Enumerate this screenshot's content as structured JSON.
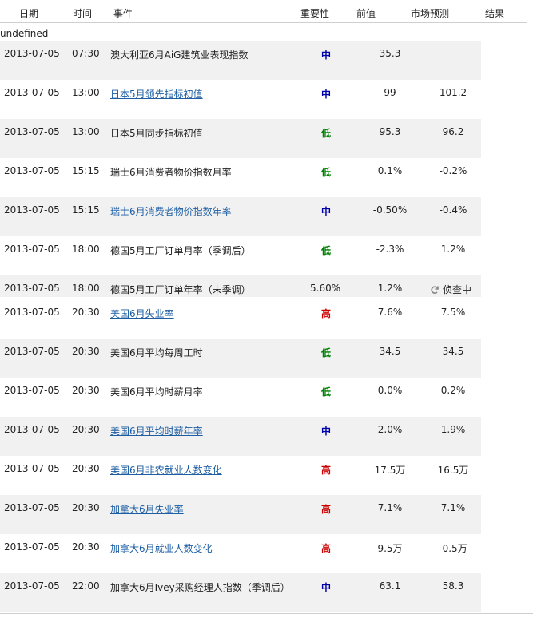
{
  "header": {
    "date": "日期",
    "time": "时间",
    "event": "事件",
    "importance": "重要性",
    "previous": "前值",
    "forecast": "市场预测",
    "result": "结果"
  },
  "undefined_text": "undefined",
  "importance_colors": {
    "低": "#008000",
    "中": "#0000aa",
    "高": "#cc0000"
  },
  "rows": [
    {
      "date": "2013-07-05",
      "time": "07:30",
      "event": "澳大利亚6月AiG建筑业表现指数",
      "link": false,
      "importance": "中",
      "previous": "35.3",
      "forecast": ""
    },
    {
      "date": "2013-07-05",
      "time": "13:00",
      "event": "日本5月领先指标初值",
      "link": true,
      "importance": "中",
      "previous": "99",
      "forecast": "101.2"
    },
    {
      "date": "2013-07-05",
      "time": "13:00",
      "event": "日本5月同步指标初值",
      "link": false,
      "importance": "低",
      "previous": "95.3",
      "forecast": "96.2"
    },
    {
      "date": "2013-07-05",
      "time": "15:15",
      "event": "瑞士6月消费者物价指数月率",
      "link": false,
      "importance": "低",
      "previous": "0.1%",
      "forecast": "-0.2%"
    },
    {
      "date": "2013-07-05",
      "time": "15:15",
      "event": "瑞士6月消费者物价指数年率",
      "link": true,
      "importance": "中",
      "previous": "-0.50%",
      "forecast": "-0.4%"
    },
    {
      "date": "2013-07-05",
      "time": "18:00",
      "event": "德国5月工厂订单月率（季调后）",
      "link": false,
      "importance": "低",
      "previous": "-2.3%",
      "forecast": "1.2%"
    },
    {
      "date": "2013-07-05",
      "time": "18:00",
      "event": "德国5月工厂订单年率（未季调）",
      "link": false,
      "importance": "",
      "actual": "5.60%",
      "previous": "1.2%",
      "forecast": "",
      "status": "侦查中"
    },
    {
      "date": "2013-07-05",
      "time": "20:30",
      "event": "美国6月失业率",
      "link": true,
      "importance": "高",
      "previous": "7.6%",
      "forecast": "7.5%"
    },
    {
      "date": "2013-07-05",
      "time": "20:30",
      "event": "美国6月平均每周工时",
      "link": false,
      "importance": "低",
      "previous": "34.5",
      "forecast": "34.5"
    },
    {
      "date": "2013-07-05",
      "time": "20:30",
      "event": "美国6月平均时薪月率",
      "link": false,
      "importance": "低",
      "previous": "0.0%",
      "forecast": "0.2%"
    },
    {
      "date": "2013-07-05",
      "time": "20:30",
      "event": "美国6月平均时薪年率",
      "link": true,
      "importance": "中",
      "previous": "2.0%",
      "forecast": "1.9%"
    },
    {
      "date": "2013-07-05",
      "time": "20:30",
      "event": "美国6月非农就业人数变化",
      "link": true,
      "importance": "高",
      "previous": "17.5万",
      "forecast": "16.5万"
    },
    {
      "date": "2013-07-05",
      "time": "20:30",
      "event": "加拿大6月失业率",
      "link": true,
      "importance": "高",
      "previous": "7.1%",
      "forecast": "7.1%"
    },
    {
      "date": "2013-07-05",
      "time": "20:30",
      "event": "加拿大6月就业人数变化",
      "link": true,
      "importance": "高",
      "previous": "9.5万",
      "forecast": "-0.5万"
    },
    {
      "date": "2013-07-05",
      "time": "22:00",
      "event": "加拿大6月Ivey采购经理人指数（季调后）",
      "link": false,
      "importance": "中",
      "previous": "63.1",
      "forecast": "58.3"
    }
  ]
}
